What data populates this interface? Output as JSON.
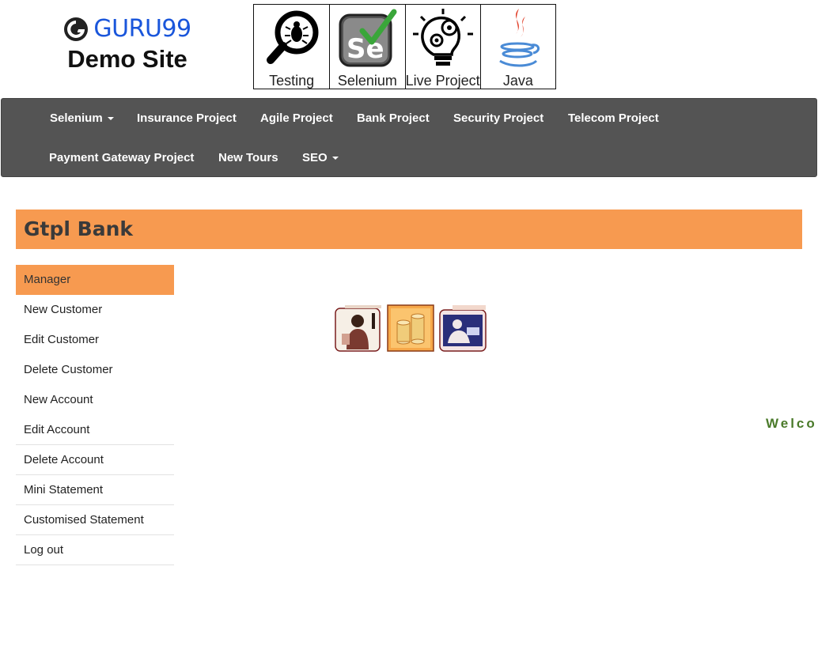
{
  "brand": {
    "name": "GURU99",
    "subtitle": "Demo Site"
  },
  "topics": [
    {
      "label": "Testing",
      "icon": "magnifier-bug-icon"
    },
    {
      "label": "Selenium",
      "icon": "selenium-logo-icon"
    },
    {
      "label": "Live Project",
      "icon": "lightbulb-gears-icon"
    },
    {
      "label": "Java",
      "icon": "java-logo-icon"
    }
  ],
  "nav": {
    "selenium": "Selenium",
    "insurance": "Insurance Project",
    "agile": "Agile Project",
    "bank": "Bank Project",
    "security": "Security Project",
    "telecom": "Telecom Project",
    "payment": "Payment Gateway Project",
    "tours": "New Tours",
    "seo": "SEO"
  },
  "banner": {
    "title": "Gtpl Bank"
  },
  "sidebar": {
    "items": [
      {
        "label": "Manager"
      },
      {
        "label": "New Customer"
      },
      {
        "label": "Edit Customer"
      },
      {
        "label": "Delete Customer"
      },
      {
        "label": "New Account"
      },
      {
        "label": "Edit Account"
      },
      {
        "label": "Delete Account"
      },
      {
        "label": "Mini Statement"
      },
      {
        "label": "Customised Statement"
      },
      {
        "label": "Log out"
      }
    ]
  },
  "marquee": {
    "text": "Welco"
  },
  "colors": {
    "nav_bg": "#545454",
    "accent": "#f79a50",
    "brand_blue": "#1a56db",
    "welcome_green": "#4a7a2a"
  }
}
